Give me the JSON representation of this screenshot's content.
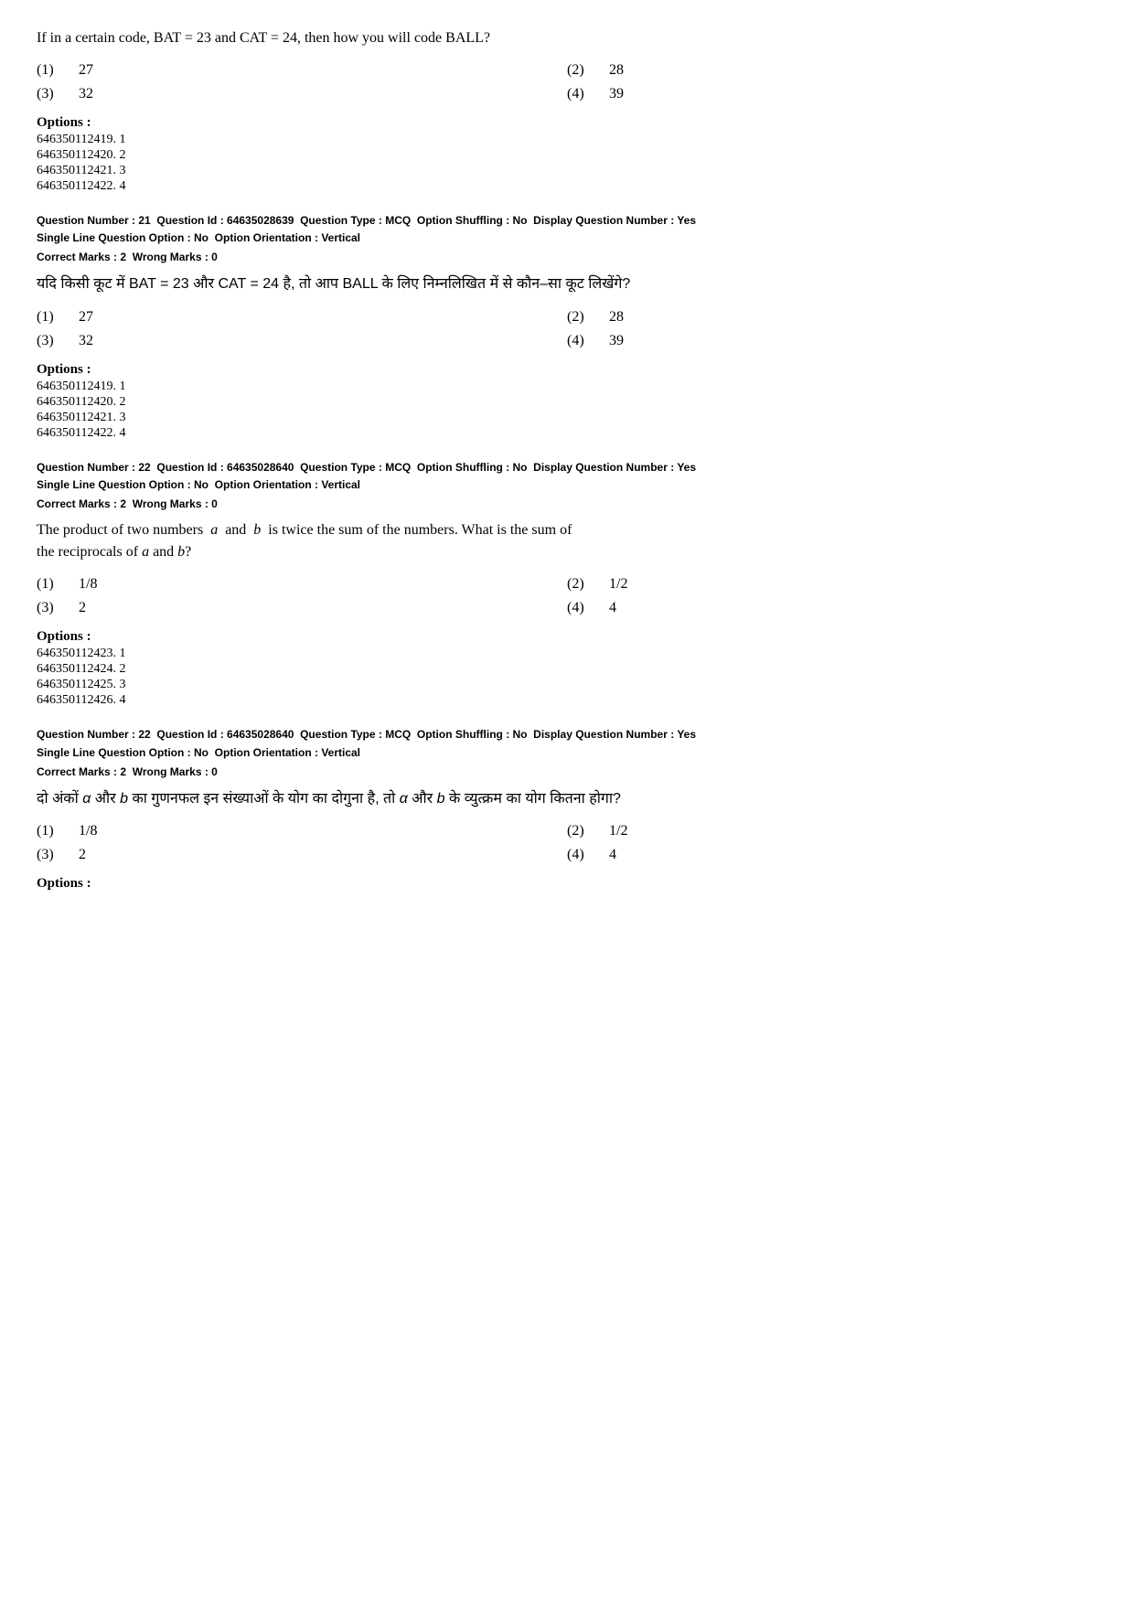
{
  "questions": [
    {
      "id": "q21_en",
      "text": "If in a certain code, BAT = 23 and CAT = 24, then how you will code BALL?",
      "options": [
        {
          "num": "(1)",
          "val": "27"
        },
        {
          "num": "(2)",
          "val": "28"
        },
        {
          "num": "(3)",
          "val": "32"
        },
        {
          "num": "(4)",
          "val": "39"
        }
      ],
      "options_label": "Options :",
      "options_ids": [
        {
          "id": "646350112419",
          "opt": "1"
        },
        {
          "id": "646350112420",
          "opt": "2"
        },
        {
          "id": "646350112421",
          "opt": "3"
        },
        {
          "id": "646350112422",
          "opt": "4"
        }
      ],
      "meta": "Question Number : 21  Question Id : 64635028639  Question Type : MCQ  Option Shuffling : No  Display Question Number : Yes",
      "meta2": "Single Line Question Option : No  Option Orientation : Vertical",
      "correct_marks": "Correct Marks : 2  Wrong Marks : 0",
      "lang": "en"
    },
    {
      "id": "q21_hi",
      "text": "यदि किसी कूट में BAT = 23 और CAT = 24 है, तो आप BALL के लिए निम्नलिखित में से कौन–सा कूट लिखेंगे?",
      "options": [
        {
          "num": "(1)",
          "val": "27"
        },
        {
          "num": "(2)",
          "val": "28"
        },
        {
          "num": "(3)",
          "val": "32"
        },
        {
          "num": "(4)",
          "val": "39"
        }
      ],
      "options_label": "Options :",
      "options_ids": [
        {
          "id": "646350112419",
          "opt": "1"
        },
        {
          "id": "646350112420",
          "opt": "2"
        },
        {
          "id": "646350112421",
          "opt": "3"
        },
        {
          "id": "646350112422",
          "opt": "4"
        }
      ],
      "meta": "Question Number : 22  Question Id : 64635028640  Question Type : MCQ  Option Shuffling : No  Display Question Number : Yes",
      "meta2": "Single Line Question Option : No  Option Orientation : Vertical",
      "correct_marks": "Correct Marks : 2  Wrong Marks : 0",
      "lang": "hi"
    },
    {
      "id": "q22_en",
      "text_part1": "The product of two numbers",
      "text_italic_a": "a",
      "text_part2": "and",
      "text_italic_b": "b",
      "text_part3": "is twice the sum of the numbers. What is the sum of the reciprocals of",
      "text_italic_a2": "a",
      "text_part4": "and",
      "text_italic_b2": "b",
      "text_part5": "?",
      "full_text": "The product of two numbers a and b is twice the sum of the numbers. What is the sum of the reciprocals of a and b?",
      "options": [
        {
          "num": "(1)",
          "val": "1/8"
        },
        {
          "num": "(2)",
          "val": "1/2"
        },
        {
          "num": "(3)",
          "val": "2"
        },
        {
          "num": "(4)",
          "val": "4"
        }
      ],
      "options_label": "Options :",
      "options_ids": [
        {
          "id": "646350112423",
          "opt": "1"
        },
        {
          "id": "646350112424",
          "opt": "2"
        },
        {
          "id": "646350112425",
          "opt": "3"
        },
        {
          "id": "646350112426",
          "opt": "4"
        }
      ],
      "meta": "Question Number : 22  Question Id : 64635028640  Question Type : MCQ  Option Shuffling : No  Display Question Number : Yes",
      "meta2": "Single Line Question Option : No  Option Orientation : Vertical",
      "correct_marks": "Correct Marks : 2  Wrong Marks : 0",
      "lang": "en"
    },
    {
      "id": "q22_hi",
      "text": "दो अंकों α और b का गुणनफल इन संख्याओं के योग का दोगुना है, तो α और b के व्युत्क्रम का योग कितना होगा?",
      "options": [
        {
          "num": "(1)",
          "val": "1/8"
        },
        {
          "num": "(2)",
          "val": "1/2"
        },
        {
          "num": "(3)",
          "val": "2"
        },
        {
          "num": "(4)",
          "val": "4"
        }
      ],
      "options_label": "Options :",
      "options_ids": [],
      "meta": "Question Number : 22  Question Id : 64635028640  Question Type : MCQ  Option Shuffling : No  Display Question Number : Yes",
      "meta2": "Single Line Question Option : No  Option Orientation : Vertical",
      "correct_marks": "Correct Marks : 2  Wrong Marks : 0",
      "lang": "hi",
      "show_options_label_only": true
    }
  ]
}
